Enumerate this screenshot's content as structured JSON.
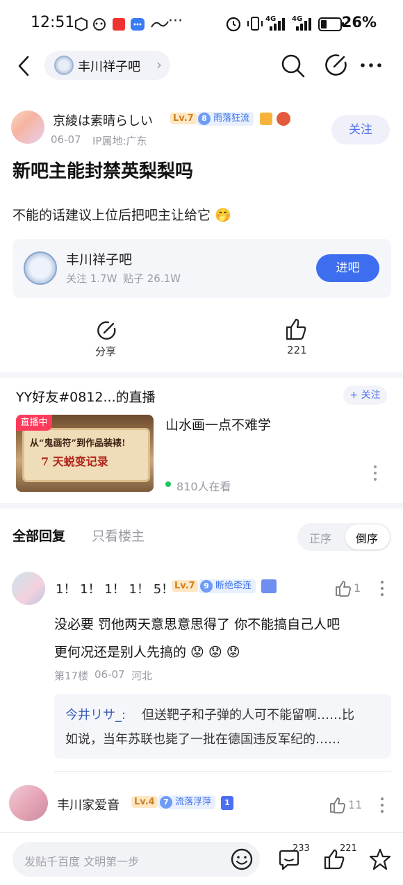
{
  "status_bar": {
    "time": "12:51",
    "network": "4G",
    "network2": "4G",
    "battery": "26%"
  },
  "nav": {
    "forum_name": "丰川祥子吧",
    "chevron": "›",
    "icons": [
      "back-icon",
      "search-icon",
      "edit-icon",
      "more-icon"
    ]
  },
  "post": {
    "author": "京綾は素晴らしい",
    "level": "Lv.7",
    "title_badge_num": "8",
    "title_badge": "雨落狂流",
    "date": "06-07",
    "ip": "IP属地:广东",
    "follow_label": "关注",
    "title": "新吧主能封禁英梨梨吗",
    "body": "不能的话建议上位后把吧主让给它 🤭"
  },
  "forum_card": {
    "name": "丰川祥子吧",
    "follow_stat": "关注 1.7W",
    "post_stat": "贴子 26.1W",
    "enter_label": "进吧"
  },
  "actions": {
    "share_label": "分享",
    "like_count": "221"
  },
  "live": {
    "header": "YY好友#0812...的直播",
    "follow_label": "+ 关注",
    "tag": "直播中",
    "thumb_text1": "从“鬼画符”到作品装裱!",
    "thumb_text2": "7 天蜕变记录",
    "title": "山水画一点不难学",
    "viewers": "810人在看"
  },
  "replies_header": {
    "all_label": "全部回复",
    "op_only_label": "只看楼主",
    "asc_label": "正序",
    "desc_label": "倒序"
  },
  "replies": [
    {
      "author": "1！ 1！ 1！ 1！ 5！",
      "level": "Lv.7",
      "badge_num": "9",
      "badge": "断绝牵连",
      "like_count": "1",
      "content_line1": "没必要 罚他两天意思意思得了 你不能搞自己人吧",
      "content_line2": "更何况还是别人先搞的 😟 😟 😟",
      "floor": "第17楼",
      "date": "06-07",
      "location": "河北",
      "quote_author": "今井リサ_:",
      "quote_line1": "但送靶子和子弹的人可不能留啊……比",
      "quote_line2": "如说，当年苏联也毙了一批在德国违反军纪的……"
    },
    {
      "author": "丰川家爱音",
      "level": "Lv.4",
      "badge_num": "7",
      "badge": "流落浮萍",
      "rank": "1",
      "like_count": "11"
    }
  ],
  "bottom_bar": {
    "input_placeholder": "发贴千百度 文明第一步",
    "comment_count": "233",
    "like_count": "221"
  },
  "colors": {
    "accent": "#3e6ef0",
    "live_tag": "#ff3b5c",
    "online_dot": "#22c55e"
  }
}
